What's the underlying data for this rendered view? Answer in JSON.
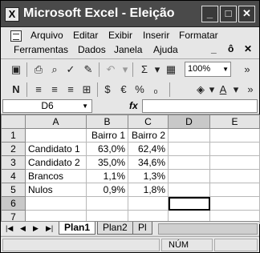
{
  "window": {
    "title": "Microsoft Excel - Eleição",
    "app_icon": "X",
    "minimize": "_",
    "maximize": "□",
    "close": "✕"
  },
  "menu": {
    "row1": [
      "Arquivo",
      "Editar",
      "Exibir",
      "Inserir",
      "Formatar"
    ],
    "row2": [
      "Ferramentas",
      "Dados",
      "Janela",
      "Ajuda"
    ],
    "win_controls": [
      "_",
      "ô",
      "✕"
    ]
  },
  "toolbar1": {
    "zoom": "100%",
    "icons": [
      "save-icon",
      "print-icon",
      "preview-icon",
      "spellcheck-icon",
      "undo-icon",
      "autosum-icon",
      "sort-icon",
      "chart-wizard-icon"
    ]
  },
  "toolbar2": {
    "icons": [
      "bold-icon",
      "align-left-icon",
      "align-center-icon",
      "align-right-icon",
      "merge-icon",
      "currency-icon",
      "euro-icon",
      "percent-icon",
      "fill-color-icon",
      "font-color-icon"
    ]
  },
  "formula": {
    "namebox": "D6",
    "fx": "fx",
    "value": ""
  },
  "grid": {
    "columns": [
      "A",
      "B",
      "C",
      "D",
      "E"
    ],
    "rows": [
      {
        "n": "1",
        "cells": [
          "",
          "Bairro 1",
          "Bairro 2",
          "",
          ""
        ]
      },
      {
        "n": "2",
        "cells": [
          "Candidato 1",
          "63,0%",
          "62,4%",
          "",
          ""
        ]
      },
      {
        "n": "3",
        "cells": [
          "Candidato 2",
          "35,0%",
          "34,6%",
          "",
          ""
        ]
      },
      {
        "n": "4",
        "cells": [
          "Brancos",
          "1,1%",
          "1,3%",
          "",
          ""
        ]
      },
      {
        "n": "5",
        "cells": [
          "Nulos",
          "0,9%",
          "1,8%",
          "",
          ""
        ]
      },
      {
        "n": "6",
        "cells": [
          "",
          "",
          "",
          "",
          ""
        ]
      },
      {
        "n": "7",
        "cells": [
          "",
          "",
          "",
          "",
          ""
        ]
      }
    ],
    "active_cell": "D6"
  },
  "tabs": [
    "Plan1",
    "Plan2",
    "Pl"
  ],
  "status": {
    "mode": "",
    "numlock": "NÚM"
  }
}
